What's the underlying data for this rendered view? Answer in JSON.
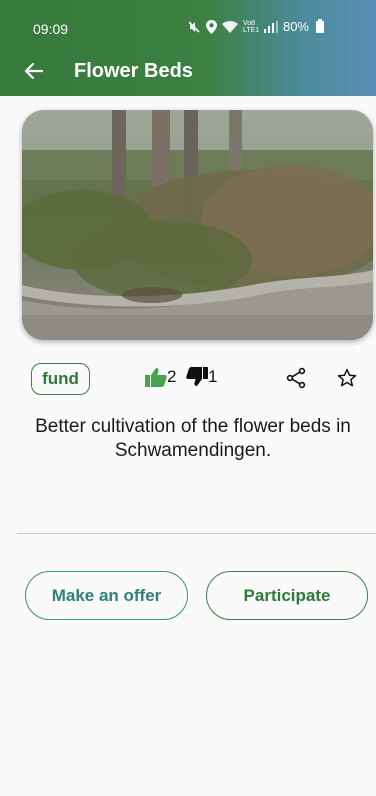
{
  "status_bar": {
    "time": "09:09",
    "network_label": "Vo8 LTE1",
    "battery": "80%"
  },
  "app_bar": {
    "title": "Flower Beds",
    "back_icon": "arrow-left-icon"
  },
  "project": {
    "tag": "fund",
    "upvotes": "2",
    "downvotes": "1",
    "description": "Better cultivation of the flower beds in Schwamendingen."
  },
  "actions": {
    "offer_label": "Make an offer",
    "participate_label": "Participate"
  },
  "icons": {
    "upvote": "thumbs-up-icon",
    "downvote": "thumbs-down-icon",
    "share": "share-icon",
    "favorite": "star-outline-icon"
  },
  "colors": {
    "primary_green": "#3d8142",
    "upvote_green": "#4aa24e",
    "offer_teal": "#3a8f8a"
  }
}
